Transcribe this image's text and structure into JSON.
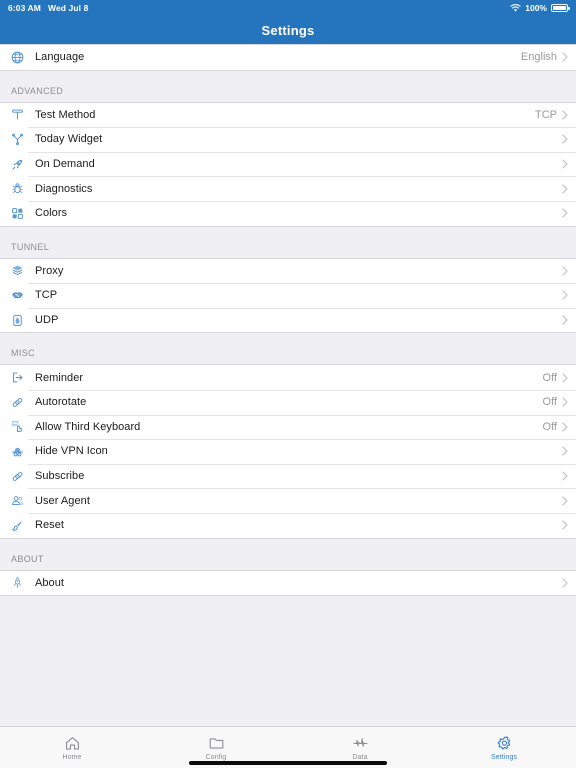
{
  "status_bar": {
    "time": "6:03 AM",
    "date": "Wed Jul 8",
    "battery_percent": "100%",
    "wifi_icon": "wifi-icon",
    "battery_icon": "battery-full-icon"
  },
  "nav": {
    "title": "Settings"
  },
  "colors": {
    "nav_background": "#2575be",
    "accent": "#4a8fd4",
    "tab_active": "#3b7fd4",
    "tab_inactive": "#8e8e93",
    "page_background": "#efeff4",
    "row_background": "#ffffff",
    "value_text": "#9a9a9f",
    "section_header_text": "#8d8d92"
  },
  "sections": [
    {
      "header": "",
      "rows": [
        {
          "label": "Language",
          "value": "English",
          "icon": "globe-icon",
          "chevron": true
        }
      ]
    },
    {
      "header": "ADVANCED",
      "rows": [
        {
          "label": "Test Method",
          "value": "TCP",
          "icon": "hammer-icon",
          "chevron": true
        },
        {
          "label": "Today Widget",
          "value": "",
          "icon": "branch-icon",
          "chevron": true
        },
        {
          "label": "On Demand",
          "value": "",
          "icon": "rocket-icon",
          "chevron": true
        },
        {
          "label": "Diagnostics",
          "value": "",
          "icon": "bug-icon",
          "chevron": true
        },
        {
          "label": "Colors",
          "value": "",
          "icon": "grid-icon",
          "chevron": true
        }
      ]
    },
    {
      "header": "TUNNEL",
      "rows": [
        {
          "label": "Proxy",
          "value": "",
          "icon": "layers-icon",
          "chevron": true
        },
        {
          "label": "TCP",
          "value": "",
          "icon": "handshake-icon",
          "chevron": true
        },
        {
          "label": "UDP",
          "value": "",
          "icon": "badge-icon",
          "chevron": true
        }
      ]
    },
    {
      "header": "MISC",
      "rows": [
        {
          "label": "Reminder",
          "value": "Off",
          "icon": "exit-arrow-icon",
          "chevron": true
        },
        {
          "label": "Autorotate",
          "value": "Off",
          "icon": "link-icon",
          "chevron": true
        },
        {
          "label": "Allow Third Keyboard",
          "value": "Off",
          "icon": "keyboard-hand-icon",
          "chevron": true
        },
        {
          "label": "Hide VPN Icon",
          "value": "",
          "icon": "incognito-icon",
          "chevron": true
        },
        {
          "label": "Subscribe",
          "value": "",
          "icon": "link-icon",
          "chevron": true
        },
        {
          "label": "User Agent",
          "value": "",
          "icon": "people-icon",
          "chevron": true
        },
        {
          "label": "Reset",
          "value": "",
          "icon": "brush-icon",
          "chevron": true
        }
      ]
    },
    {
      "header": "ABOUT",
      "rows": [
        {
          "label": "About",
          "value": "",
          "icon": "rocket-pin-icon",
          "chevron": true
        }
      ]
    }
  ],
  "tabs": [
    {
      "label": "Home",
      "icon": "house-icon",
      "active": false
    },
    {
      "label": "Config",
      "icon": "folder-icon",
      "active": false
    },
    {
      "label": "Data",
      "icon": "waveform-icon",
      "active": false
    },
    {
      "label": "Settings",
      "icon": "gear-icon",
      "active": true
    }
  ]
}
